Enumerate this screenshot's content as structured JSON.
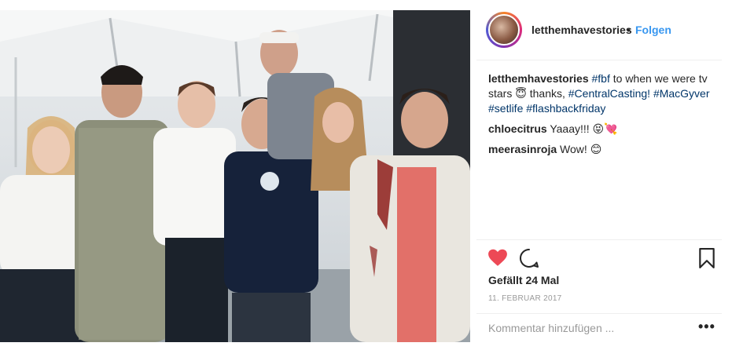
{
  "post": {
    "username": "letthemhavestories",
    "separator": "•",
    "follow_label": "Folgen",
    "caption": {
      "user": "letthemhavestories",
      "parts": [
        {
          "text": " ",
          "tag": false
        },
        {
          "text": "#fbf",
          "tag": true
        },
        {
          "text": " to when we were tv stars ",
          "tag": false
        },
        {
          "text": "😇",
          "tag": false
        },
        {
          "text": " thanks, ",
          "tag": false
        },
        {
          "text": "#CentralCasting!",
          "tag": true
        },
        {
          "text": " ",
          "tag": false
        },
        {
          "text": "#MacGyver",
          "tag": true
        },
        {
          "text": " ",
          "tag": false
        },
        {
          "text": "#setlife",
          "tag": true
        },
        {
          "text": " ",
          "tag": false
        },
        {
          "text": "#flashbackfriday",
          "tag": true
        }
      ]
    },
    "comments": [
      {
        "user": "chloecitrus",
        "text": " Yaaay!!! 😝💘"
      },
      {
        "user": "meerasinroja",
        "text": " Wow! 😊"
      }
    ],
    "likes_label": "Gefällt 24 Mal",
    "date": "11. FEBRUAR 2017",
    "add_comment_placeholder": "Kommentar hinzufügen ...",
    "more_label": "•••"
  },
  "icons": {
    "heart": "heart-icon",
    "comment": "comment-icon",
    "bookmark": "bookmark-icon",
    "more": "more-options-icon"
  },
  "colors": {
    "heart": "#ed4956",
    "link": "#3897f0",
    "hashtag": "#003569",
    "muted": "#999999"
  }
}
